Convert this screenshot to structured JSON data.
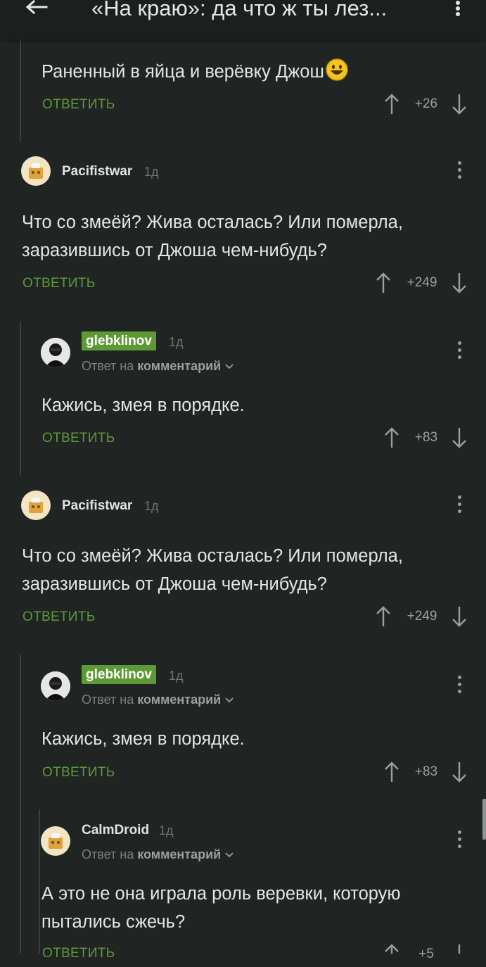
{
  "appbar": {
    "title": "«На краю»: да что ж ты лез..."
  },
  "comments": [
    {
      "text": "Раненный в яйца и верёвку Джош",
      "reply_label": "ОТВЕТИТЬ",
      "votes": "+26"
    },
    {
      "user": "Pacifistwar",
      "time": "1д",
      "text": "Что со змеёй? Жива осталась? Или померла,\nзаразившись от Джоша чем-нибудь?",
      "reply_label": "ОТВЕТИТЬ",
      "votes": "+249"
    },
    {
      "user": "glebklinov",
      "time": "1д",
      "reply_to_prefix": "Ответ на",
      "reply_to_target": "комментарий",
      "text": "Кажись, змея в порядке.",
      "reply_label": "ОТВЕТИТЬ",
      "votes": "+83"
    },
    {
      "user": "Pacifistwar",
      "time": "1д",
      "text": "Что со змеёй? Жива осталась? Или померла,\nзаразившись от Джоша чем-нибудь?",
      "reply_label": "ОТВЕТИТЬ",
      "votes": "+249"
    },
    {
      "user": "glebklinov",
      "time": "1д",
      "reply_to_prefix": "Ответ на",
      "reply_to_target": "комментарий",
      "text": "Кажись, змея в порядке.",
      "reply_label": "ОТВЕТИТЬ",
      "votes": "+83"
    },
    {
      "user": "CalmDroid",
      "time": "1д",
      "reply_to_prefix": "Ответ на",
      "reply_to_target": "комментарий",
      "text": "А это не она играла роль веревки, которую\nпытались сжечь?",
      "reply_label": "ОТВЕТИТЬ",
      "votes": "+5"
    }
  ],
  "colors": {
    "background": "#202524",
    "accent_green": "#5d9a36",
    "text": "#e3e6e4",
    "muted": "#9aa09e"
  },
  "icons": [
    "back-arrow-icon",
    "more-vert-icon",
    "upvote-arrow-icon",
    "downvote-arrow-icon",
    "chevron-down-icon",
    "smiley-emoji-icon"
  ]
}
